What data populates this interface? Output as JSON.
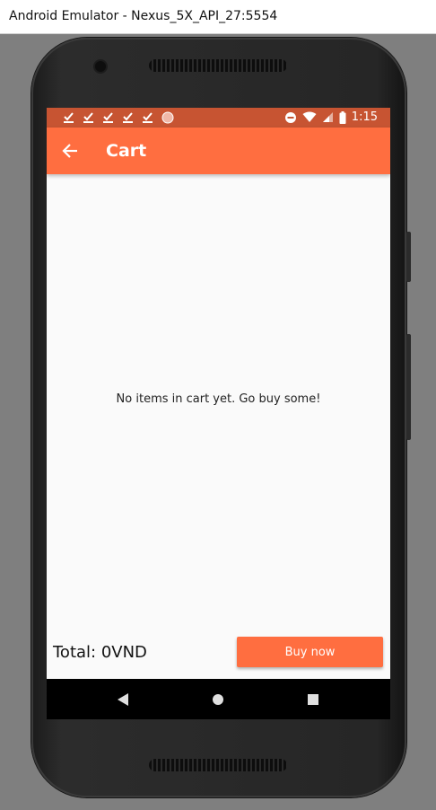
{
  "window": {
    "title": "Android Emulator - Nexus_5X_API_27:5554"
  },
  "status_bar": {
    "notification_icons": [
      "download-done-icon",
      "download-done-icon",
      "download-done-icon",
      "download-done-icon",
      "download-done-icon",
      "circle-notification-icon"
    ],
    "right_icons": [
      "do-not-disturb-icon",
      "wifi-icon",
      "signal-icon",
      "battery-icon"
    ],
    "time": "1:15"
  },
  "app_bar": {
    "title": "Cart",
    "back_icon": "arrow-back-icon"
  },
  "cart": {
    "empty_message": "No items in cart yet. Go buy some!",
    "total": "Total: 0VND",
    "buy_label": "Buy now"
  },
  "nav_bar": {
    "icons": [
      "back-triangle-icon",
      "home-circle-icon",
      "recents-square-icon"
    ]
  },
  "colors": {
    "primary": "#ff6e40",
    "status_bar": "#c75432",
    "background": "#fafafa"
  }
}
